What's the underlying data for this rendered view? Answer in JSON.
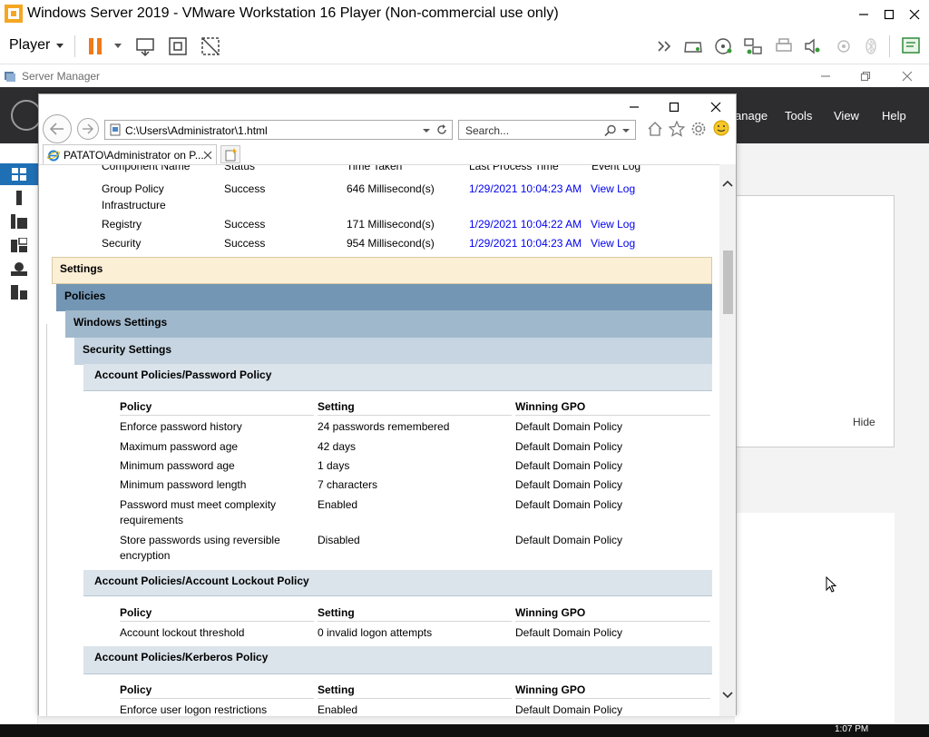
{
  "vmware": {
    "title": "Windows Server 2019 - VMware Workstation 16 Player (Non-commercial use only)",
    "player_menu": "Player"
  },
  "server_manager": {
    "title": "Server Manager",
    "menu": [
      "anage",
      "Tools",
      "View",
      "Help"
    ],
    "hide_label": "Hide"
  },
  "ie": {
    "address": "C:\\Users\\Administrator\\1.html",
    "search_placeholder": "Search...",
    "tab_title": "PATATO\\Administrator on P..."
  },
  "report": {
    "partial_headers": [
      "Component Name",
      "Status",
      "Time Taken",
      "Last Process Time",
      "Event Log"
    ],
    "components": [
      {
        "name_line1": "Group Policy",
        "name_line2": "Infrastructure",
        "status": "Success",
        "time": "646 Millisecond(s)",
        "last": "1/29/2021 10:04:23 AM",
        "log": "View Log"
      },
      {
        "name_line1": "Registry",
        "name_line2": "",
        "status": "Success",
        "time": "171 Millisecond(s)",
        "last": "1/29/2021 10:04:22 AM",
        "log": "View Log"
      },
      {
        "name_line1": "Security",
        "name_line2": "",
        "status": "Success",
        "time": "954 Millisecond(s)",
        "last": "1/29/2021 10:04:23 AM",
        "log": "View Log"
      }
    ],
    "sections": {
      "settings": "Settings",
      "policies": "Policies",
      "windows_settings": "Windows Settings",
      "security_settings": "Security Settings"
    },
    "columns": {
      "policy": "Policy",
      "setting": "Setting",
      "gpo": "Winning GPO"
    },
    "password_policy": {
      "title": "Account Policies/Password Policy",
      "rows": [
        {
          "policy": "Enforce password history",
          "policy2": "",
          "setting": "24 passwords remembered",
          "gpo": "Default Domain Policy"
        },
        {
          "policy": "Maximum password age",
          "policy2": "",
          "setting": "42 days",
          "gpo": "Default Domain Policy"
        },
        {
          "policy": "Minimum password age",
          "policy2": "",
          "setting": "1 days",
          "gpo": "Default Domain Policy"
        },
        {
          "policy": "Minimum password length",
          "policy2": "",
          "setting": "7 characters",
          "gpo": "Default Domain Policy"
        },
        {
          "policy": "Password must meet complexity",
          "policy2": "requirements",
          "setting": "Enabled",
          "gpo": "Default Domain Policy"
        },
        {
          "policy": "Store passwords using reversible",
          "policy2": "encryption",
          "setting": "Disabled",
          "gpo": "Default Domain Policy"
        }
      ]
    },
    "lockout_policy": {
      "title": "Account Policies/Account Lockout Policy",
      "rows": [
        {
          "policy": "Account lockout threshold",
          "setting": "0 invalid logon attempts",
          "gpo": "Default Domain Policy"
        }
      ]
    },
    "kerberos_policy": {
      "title": "Account Policies/Kerberos Policy",
      "rows": [
        {
          "policy": "Enforce user logon restrictions",
          "setting": "Enabled",
          "gpo": "Default Domain Policy"
        }
      ]
    }
  },
  "taskbar": {
    "clock": "1:07 PM"
  },
  "colors": {
    "settings_bar": "#fbefd6",
    "policies_bar": "#7396b4",
    "windows_settings_bar": "#a0b8cc",
    "security_settings_bar": "#c6d5e1",
    "subsection_bar": "#dbe4eb",
    "link": "#0000ee",
    "sm_header": "#2d2d30"
  }
}
